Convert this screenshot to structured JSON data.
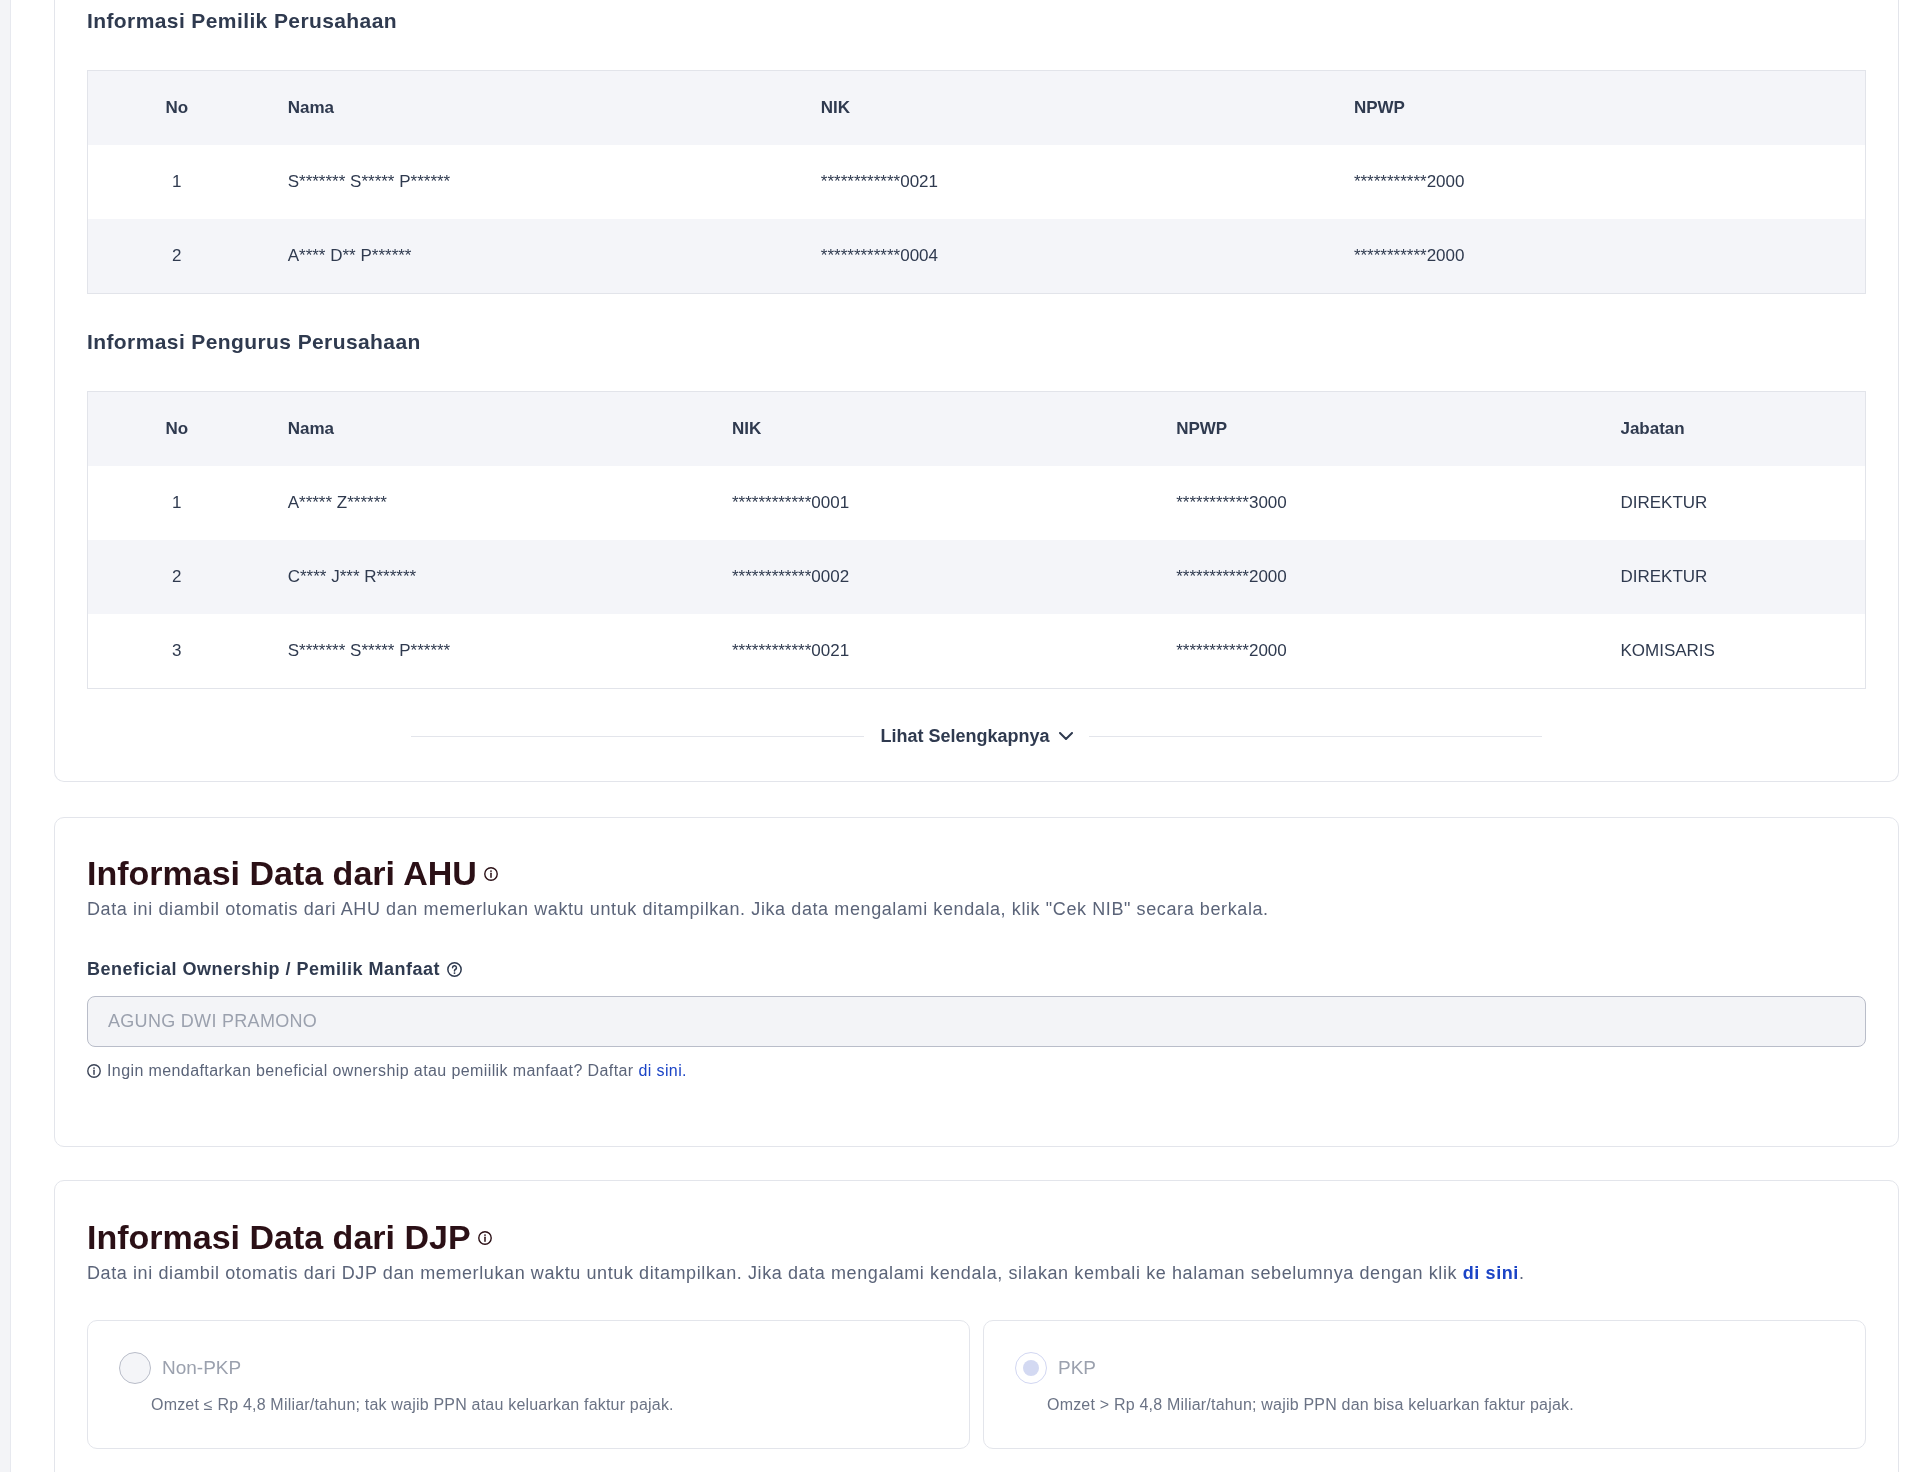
{
  "company_tables": [
    {
      "title": "Informasi Pemilik Perusahaan",
      "columns": [
        "No",
        "Nama",
        "NIK",
        "NPWP"
      ],
      "rows": [
        [
          "1",
          "S******* S***** P******",
          "************0021",
          "***********2000"
        ],
        [
          "2",
          "A**** D** P******",
          "************0004",
          "***********2000"
        ]
      ]
    },
    {
      "title": "Informasi Pengurus Perusahaan",
      "columns": [
        "No",
        "Nama",
        "NIK",
        "NPWP",
        "Jabatan"
      ],
      "rows": [
        [
          "1",
          "A***** Z******",
          "************0001",
          "***********3000",
          "DIREKTUR"
        ],
        [
          "2",
          "C**** J*** R******",
          "************0002",
          "***********2000",
          "DIREKTUR"
        ],
        [
          "3",
          "S******* S***** P******",
          "************0021",
          "***********2000",
          "KOMISARIS"
        ]
      ]
    }
  ],
  "show_more": "Lihat Selengkapnya",
  "ahu": {
    "title": "Informasi Data dari AHU",
    "description": "Data ini diambil otomatis dari AHU dan memerlukan waktu untuk ditampilkan. Jika data mengalami kendala, klik \"Cek NIB\" secara berkala.",
    "field": {
      "label": "Beneficial Ownership / Pemilik Manfaat",
      "value": "AGUNG DWI PRAMONO",
      "disabled": true
    },
    "help": {
      "text": "Ingin mendaftarkan beneficial ownership atau pemiilik manfaat? Daftar",
      "link": "di sini."
    }
  },
  "djp": {
    "title": "Informasi Data dari DJP",
    "description": "Data ini diambil otomatis dari DJP dan memerlukan waktu untuk ditampilkan. Jika data mengalami kendala, silakan kembali ke halaman sebelumnya dengan klik",
    "link": "di sini",
    "description_end": ".",
    "options": [
      {
        "label": "Non-PKP",
        "description": "Omzet ≤ Rp 4,8 Miliar/tahun; tak wajib PPN atau keluarkan faktur pajak.",
        "selected": false,
        "disabled": true
      },
      {
        "label": "PKP",
        "description": "Omzet > Rp 4,8 Miliar/tahun; wajib PPN dan bisa keluarkan faktur pajak.",
        "selected": true,
        "disabled": true
      }
    ]
  }
}
